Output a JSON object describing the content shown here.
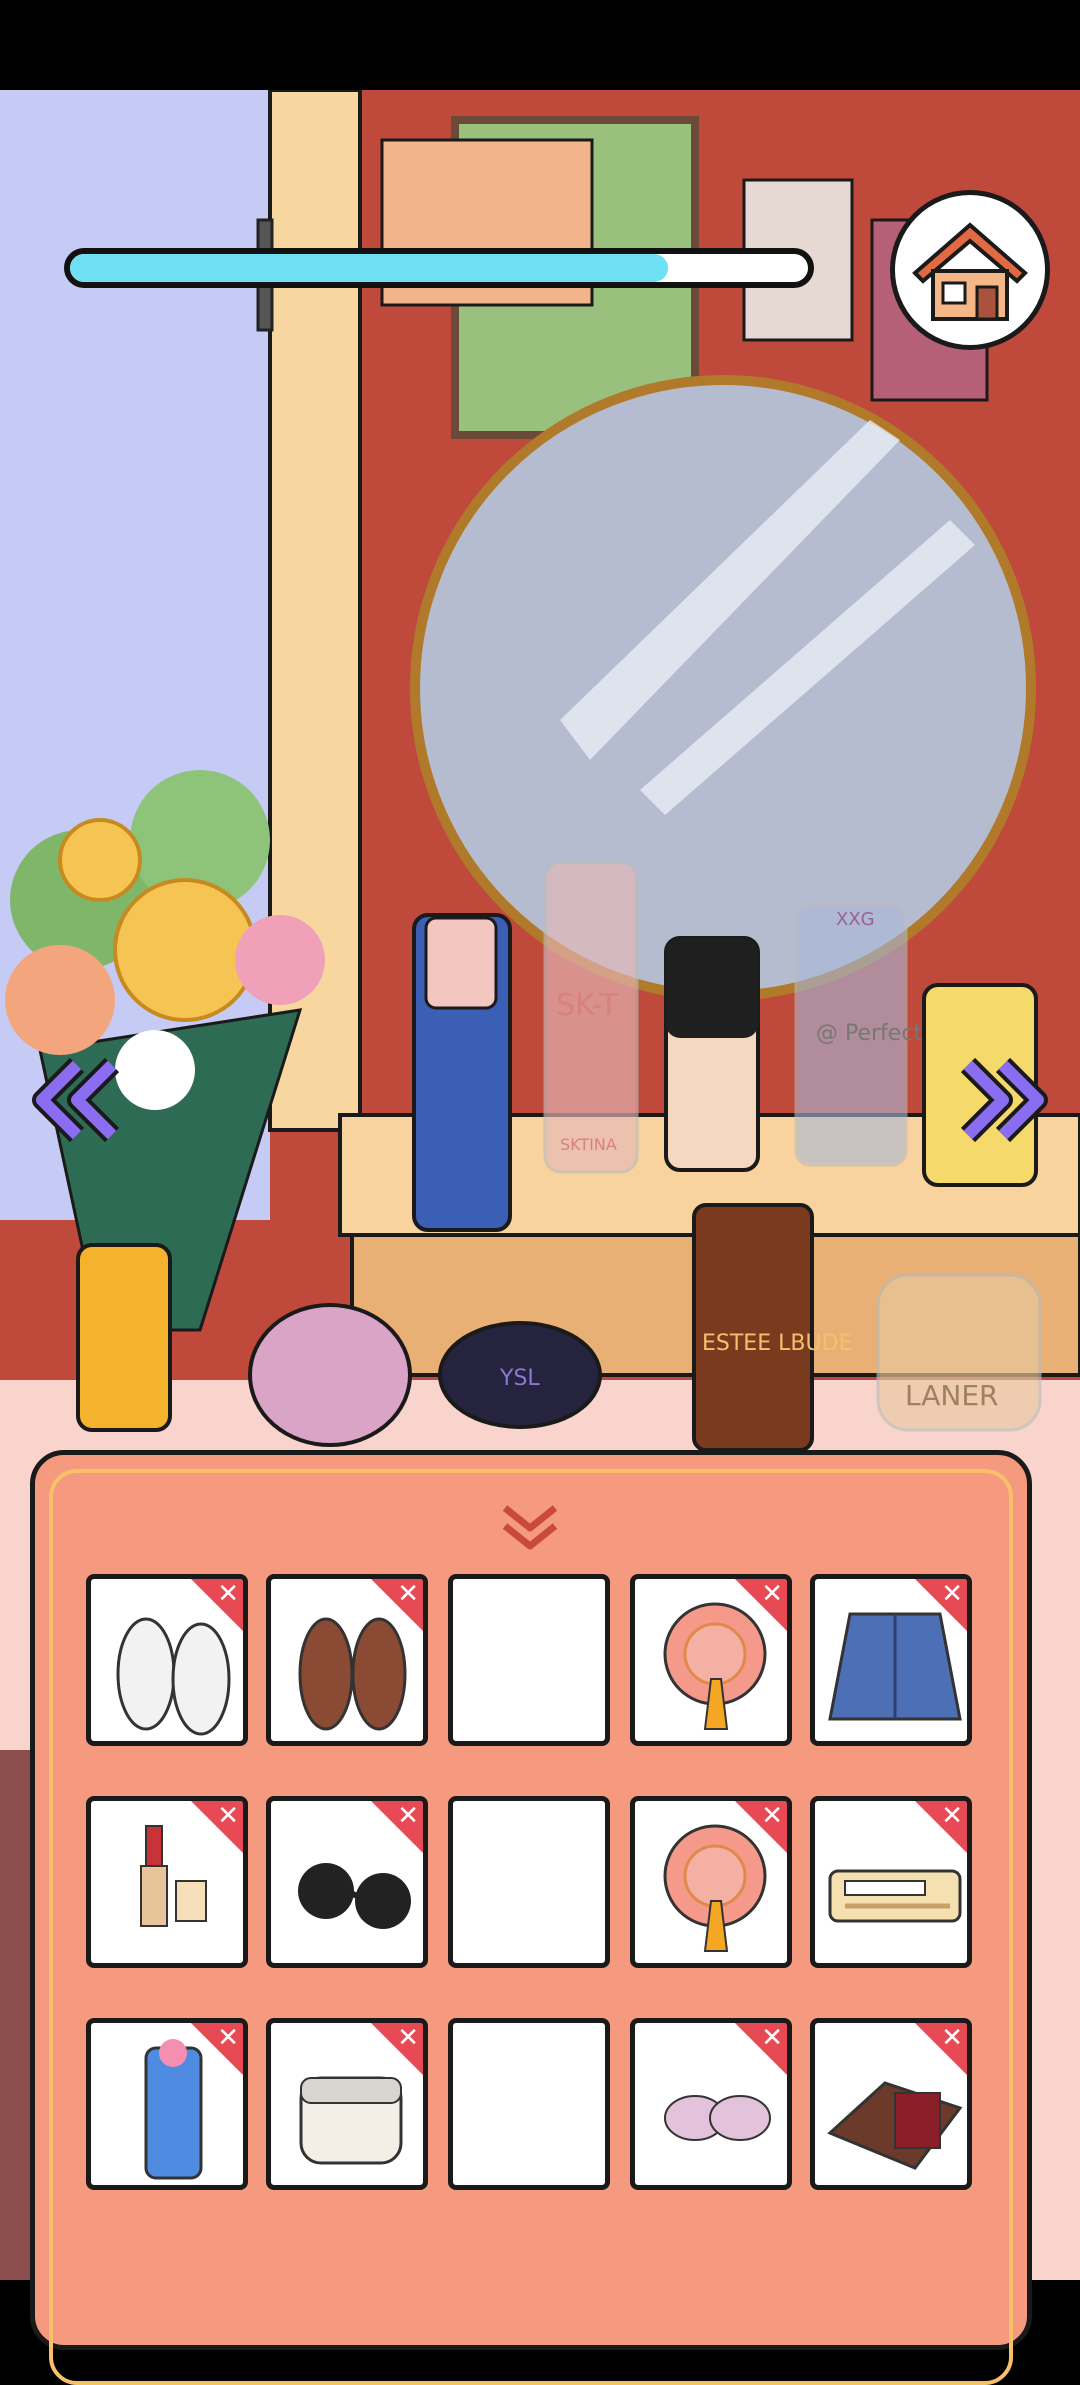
{
  "game": {
    "progress_fraction": 0.81,
    "home_button": "home-icon",
    "prev_button": "double-chevron-left-icon",
    "next_button": "double-chevron-right-icon",
    "collapse_button": "double-chevron-down-icon"
  },
  "scene_labels": {
    "skt_bottle": "SK-T",
    "skt_bottle_base": "SKTINA",
    "tube_brand": "@ Perfect Mhop",
    "tube_badge": "XXG",
    "serum_brand": "ESTEE LBUDE",
    "jar_brand": "LANER",
    "cushion_logo": "YSL"
  },
  "inventory": {
    "rows": [
      [
        {
          "item": "white-sneakers",
          "removable": true
        },
        {
          "item": "brown-oxford-shoes",
          "removable": true
        },
        {
          "item": "empty-slot",
          "removable": false
        },
        {
          "item": "pink-sun-hat",
          "removable": true
        },
        {
          "item": "denim-jacket",
          "removable": true
        }
      ],
      [
        {
          "item": "lipstick-set",
          "removable": true
        },
        {
          "item": "sunglasses",
          "removable": true
        },
        {
          "item": "empty-slot",
          "removable": false
        },
        {
          "item": "pink-sun-hat",
          "removable": true
        },
        {
          "item": "toothbrush-kit",
          "removable": true
        }
      ],
      [
        {
          "item": "cleanser-tube",
          "removable": true,
          "label": "Perfect Mhop"
        },
        {
          "item": "cream-jar",
          "removable": true,
          "label": "LANER"
        },
        {
          "item": "empty-slot",
          "removable": false
        },
        {
          "item": "lace-bra",
          "removable": true
        },
        {
          "item": "passport-wallet",
          "removable": true
        }
      ]
    ],
    "remove_mark": "✕"
  }
}
